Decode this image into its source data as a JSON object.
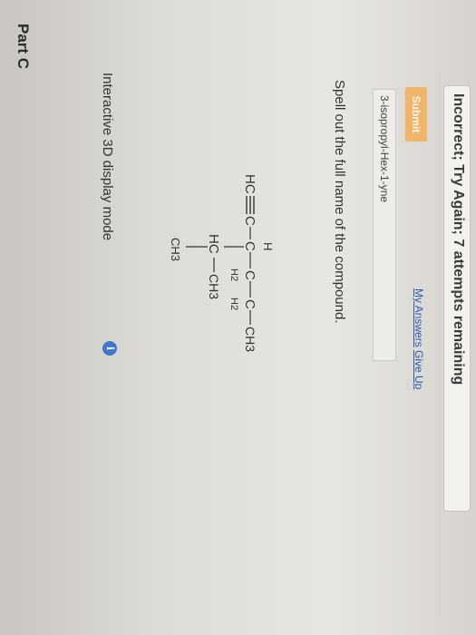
{
  "part": {
    "title": "Part C"
  },
  "interactive": {
    "label": "Interactive 3D display mode",
    "info_icon": "i"
  },
  "molecule": {
    "main_chain": [
      "HC",
      "C",
      "C",
      "C",
      "C",
      "CH3"
    ],
    "labels": {
      "hc": "HC",
      "c1": "C",
      "c2": "C",
      "h_top": "H",
      "c3": "C",
      "h2_a": "H2",
      "c4": "C",
      "h2_b": "H2",
      "ch3_end": "CH3",
      "hc_branch": "HC",
      "ch3_branch_right": "CH3",
      "ch3_branch_down": "CH3"
    }
  },
  "question": {
    "prompt": "Spell out the full name of the compound."
  },
  "answer": {
    "value": "3-isopropyl-Hex-1-yne"
  },
  "actions": {
    "submit_label": "Submit",
    "my_answers_label": "My Answers",
    "give_up_label": "Give Up"
  },
  "feedback": {
    "text": "Incorrect; Try Again; 7 attempts remaining"
  }
}
